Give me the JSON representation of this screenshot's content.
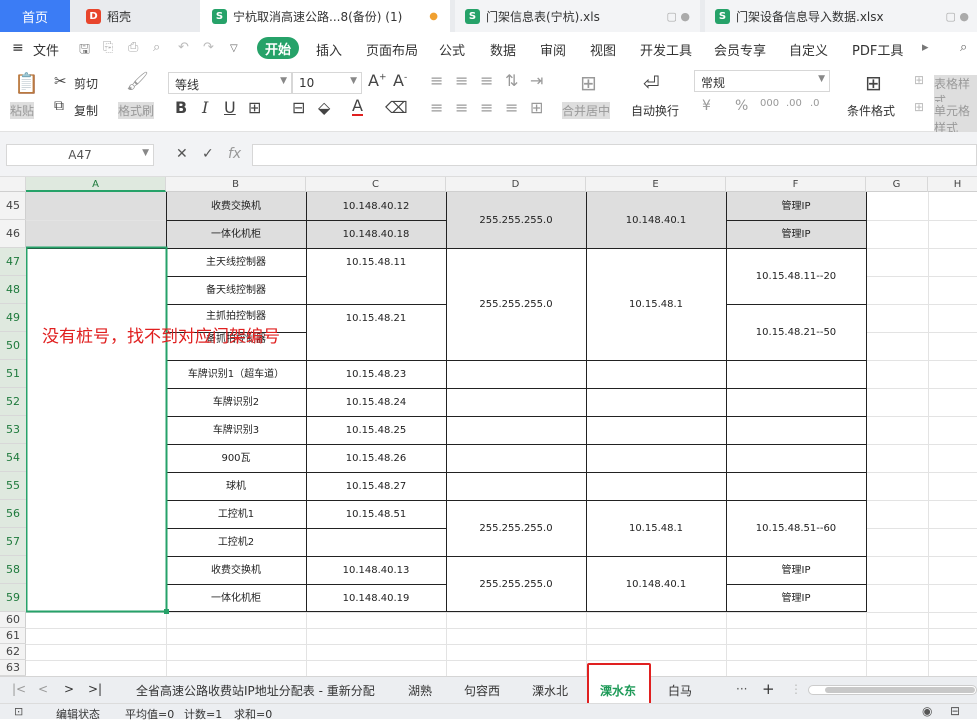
{
  "tabs": [
    {
      "label": "首页"
    },
    {
      "label": "稻壳"
    },
    {
      "label": "宁杭取消高速公路...8(备份) (1)"
    },
    {
      "label": "门架信息表(宁杭).xls"
    },
    {
      "label": "门架设备信息导入数据.xlsx"
    }
  ],
  "menu": {
    "file": "文件",
    "items": [
      "开始",
      "插入",
      "页面布局",
      "公式",
      "数据",
      "审阅",
      "视图",
      "开发工具",
      "会员专享",
      "自定义",
      "PDF工具"
    ]
  },
  "ribbon": {
    "paste": "粘贴",
    "cut": "剪切",
    "copy": "复制",
    "format_painter": "格式刷",
    "font_name": "等线",
    "font_size": "10",
    "merge_center": "合并居中",
    "wrap_text": "自动换行",
    "number_format": "常规",
    "conditional_format": "条件格式",
    "table_style": "表格样式",
    "cell_style": "单元格样式"
  },
  "formula_bar": {
    "name_box": "A47",
    "fx": "fx",
    "value": ""
  },
  "columns": [
    "A",
    "B",
    "C",
    "D",
    "E",
    "F",
    "G",
    "H"
  ],
  "rows": [
    "45",
    "46",
    "47",
    "48",
    "49",
    "50",
    "51",
    "52",
    "53",
    "54",
    "55",
    "56",
    "57",
    "58",
    "59",
    "60",
    "61",
    "62",
    "63"
  ],
  "cells": {
    "b45": "收费交换机",
    "c45": "10.148.40.12",
    "d45": "255.255.255.0",
    "e45": "10.148.40.1",
    "f45": "管理IP",
    "b46": "一体化机柜",
    "c46": "10.148.40.18",
    "f46": "管理IP",
    "b47": "主天线控制器",
    "c47": "10.15.48.11",
    "d47": "255.255.255.0",
    "e47": "10.15.48.1",
    "f47": "10.15.48.11--20",
    "b48": "备天线控制器",
    "b49": "主抓拍控制器",
    "c49": "10.15.48.21",
    "f49": "10.15.48.21--50",
    "b50": "备抓拍控制器",
    "b51": "车牌识别1（超车道）",
    "c51": "10.15.48.23",
    "b52": "车牌识别2",
    "c52": "10.15.48.24",
    "b53": "车牌识别3",
    "c53": "10.15.48.25",
    "b54": "900瓦",
    "c54": "10.15.48.26",
    "b55": "球机",
    "c55": "10.15.48.27",
    "b56": "工控机1",
    "c56": "10.15.48.51",
    "d56": "255.255.255.0",
    "e56": "10.15.48.1",
    "f56": "10.15.48.51--60",
    "b57": "工控机2",
    "b58": "收费交换机",
    "c58": "10.148.40.13",
    "d58": "255.255.255.0",
    "e58": "10.148.40.1",
    "f58": "管理IP",
    "b59": "一体化机柜",
    "c59": "10.148.40.19",
    "f59": "管理IP"
  },
  "annotation": "没有桩号，找不到对应门架编号",
  "sheets": [
    "全省高速公路收费站IP地址分配表 - 重新分配",
    "湖熟",
    "句容西",
    "溧水北",
    "溧水东",
    "白马"
  ],
  "active_sheet": "溧水东",
  "status": {
    "mode": "编辑状态",
    "avg": "平均值=0",
    "count": "计数=1",
    "sum": "求和=0"
  },
  "colors": {
    "accent": "#26a269",
    "highlight_box": "#e02020",
    "annotation_text": "#e02020",
    "home_tab": "#3b7cf5"
  }
}
